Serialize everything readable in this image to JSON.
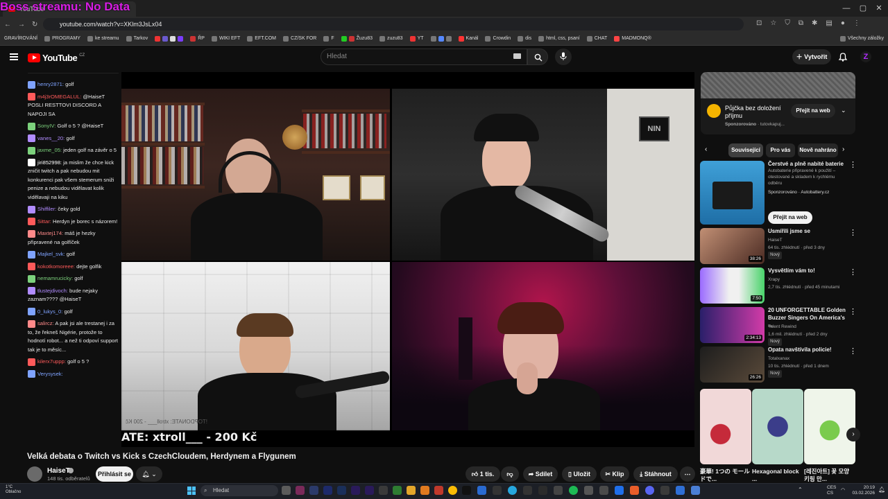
{
  "browser": {
    "overlay_title": "Boss streamu: No Data",
    "tab_title": "YouTube",
    "url": "youtube.com/watch?v=XKlm3JsLx04",
    "bookmarks": [
      "GRAVÍROVÁNÍ",
      "PROGRAMY",
      "ke streamu",
      "Tarkov",
      "ŘP",
      "WIKI EFT",
      "EFT.COM",
      "CZ/SK FOR",
      "F",
      "Žuzu83",
      "zuzu83",
      "YT",
      "Kanál",
      "Crowdin",
      "dis",
      "html, css, psaní",
      "CHAT",
      "MADMONQ®",
      "Všechny záložky"
    ]
  },
  "header": {
    "logo_text": "YouTube",
    "logo_region": "CZ",
    "search_placeholder": "Hledat",
    "create_label": "Vytvořit",
    "avatar_letter": "Z"
  },
  "chat": {
    "messages": [
      {
        "user": "henry2871:",
        "text": "golf",
        "color": "#7fa3ff"
      },
      {
        "user": "m4j3rOMEGALUL:",
        "text": "@HaiseT POSLI RESTTOVI DISCORD A NAPOJI SA",
        "color": "#ff5a5a"
      },
      {
        "user": "SonyIV:",
        "text": "Golf o 5 ? @HaiseT",
        "color": "#7cd17c"
      },
      {
        "user": "vanes__20:",
        "text": "golf",
        "color": "#b18cff"
      },
      {
        "user": "jaxme_05:",
        "text": "jeden golf na závěr o 5",
        "color": "#7cd17c"
      },
      {
        "user": "jiri852998:",
        "text": "ja mislim že chce kick zničit twitch a pak nebudou mit konkurenci pak všem stemerum sniži penize a nebudou vidělavat kolik vidělavaji na kiku",
        "color": "#ffffff"
      },
      {
        "user": "Shiffiler:",
        "text": "čeky gold",
        "color": "#b18cff"
      },
      {
        "user": "Sittar:",
        "text": "Herdyn je borec s názorem!",
        "color": "#ff5a5a"
      },
      {
        "user": "Maxtej174:",
        "text": "máš je hezky připravené na golfíček",
        "color": "#ff8a8a"
      },
      {
        "user": "Majkel_svk:",
        "text": "golf",
        "color": "#7fa3ff"
      },
      {
        "user": "kokotkomoreee:",
        "text": "dejte golfik",
        "color": "#ff5a5a"
      },
      {
        "user": "nemamrucicky:",
        "text": "golf",
        "color": "#7cd17c"
      },
      {
        "user": "tlustejdivoch:",
        "text": "bude nejaky zaznam???? @HaiseT",
        "color": "#b18cff"
      },
      {
        "user": "0_lukys_0:",
        "text": "golf",
        "color": "#7fa3ff"
      },
      {
        "user": "salircz:",
        "text": "A pak jsi ale trestanej i za to, že řekneš Nigérie, protože to hodnotí robot... a než ti odpoví support tak je to měsíc...",
        "color": "#ff8a8a"
      },
      {
        "user": "kilerx7uppp:",
        "text": "golf o 5 ?",
        "color": "#ff5a5a"
      },
      {
        "user": "Verysysek:",
        "text": "",
        "color": "#7fa3ff"
      }
    ]
  },
  "player": {
    "donate_banner": "ATE: xtroll___ - 200 Kč",
    "mirrored_text": "!TOPDONATE: xtroll___ - 200 Kč"
  },
  "video": {
    "title": "Velká debata o Twitch vs Kick s CzechCloudem, Herdynem a Flygunem",
    "channel": "HaiseT",
    "subscribers": "148 tis. odběratelů",
    "subscribe_label": "Přihlásit se",
    "likes": "1 tis.",
    "share_label": "Sdílet",
    "save_label": "Uložit",
    "clip_label": "Klip",
    "download_label": "Stáhnout"
  },
  "sidebar": {
    "ad": {
      "title": "Půjčka bez doložení příjmu",
      "sponsor_label": "Sponzorováno",
      "sponsor_domain": "tutovkapuj...",
      "button": "Přejít na web"
    },
    "chips": [
      "Související",
      "Pro vás",
      "Nově nahráno"
    ],
    "videos": [
      {
        "title": "Čerstvé a plně nabité baterie",
        "line1": "Autobaterie připravené k použití – otestované a skladem k rychlému odběru",
        "line2": "Sponzorováno · Autobattery.cz",
        "duration": "",
        "badge": "",
        "button": "Přejít na web"
      },
      {
        "title": "Usmířili jsme se",
        "line1": "HaiseT",
        "line2": "64 tis. zhlédnutí · před 3 dny",
        "duration": "38:26",
        "badge": "Nový"
      },
      {
        "title": "Vysvětlím vám to!",
        "line1": "Xrapy",
        "line2": "2,7 tis. zhlédnutí · před 45 minutami",
        "duration": "7:50",
        "badge": ""
      },
      {
        "title": "20 UNFORGETTABLE Golden Buzzer Singers On America's ...",
        "line1": "Talent Rewind",
        "line2": "1,6 mil. zhlédnutí · před 2 dny",
        "duration": "2:34:13",
        "badge": "Nový"
      },
      {
        "title": "Opata navštívila policie!",
        "line1": "Totalxanax",
        "line2": "10 tis. zhlédnutí · před 1 dnem",
        "duration": "26:26",
        "badge": "Nový"
      }
    ],
    "shorts": [
      {
        "title": "豪華! 1つの モールドで..."
      },
      {
        "title": "Hexagonal block ..."
      },
      {
        "title": "[레진아트] 꽃 모양 키링 만..."
      }
    ]
  },
  "taskbar": {
    "weather_temp": "1°C",
    "weather_text": "Oblačno",
    "search_placeholder": "Hledat",
    "lang_top": "CES",
    "lang_bottom": "CS",
    "time": "20:19",
    "date": "03.02.2026"
  },
  "colors": {
    "accent_red": "#ff0000",
    "overlay_magenta": "#d71de4",
    "background": "#0f0f0f"
  }
}
